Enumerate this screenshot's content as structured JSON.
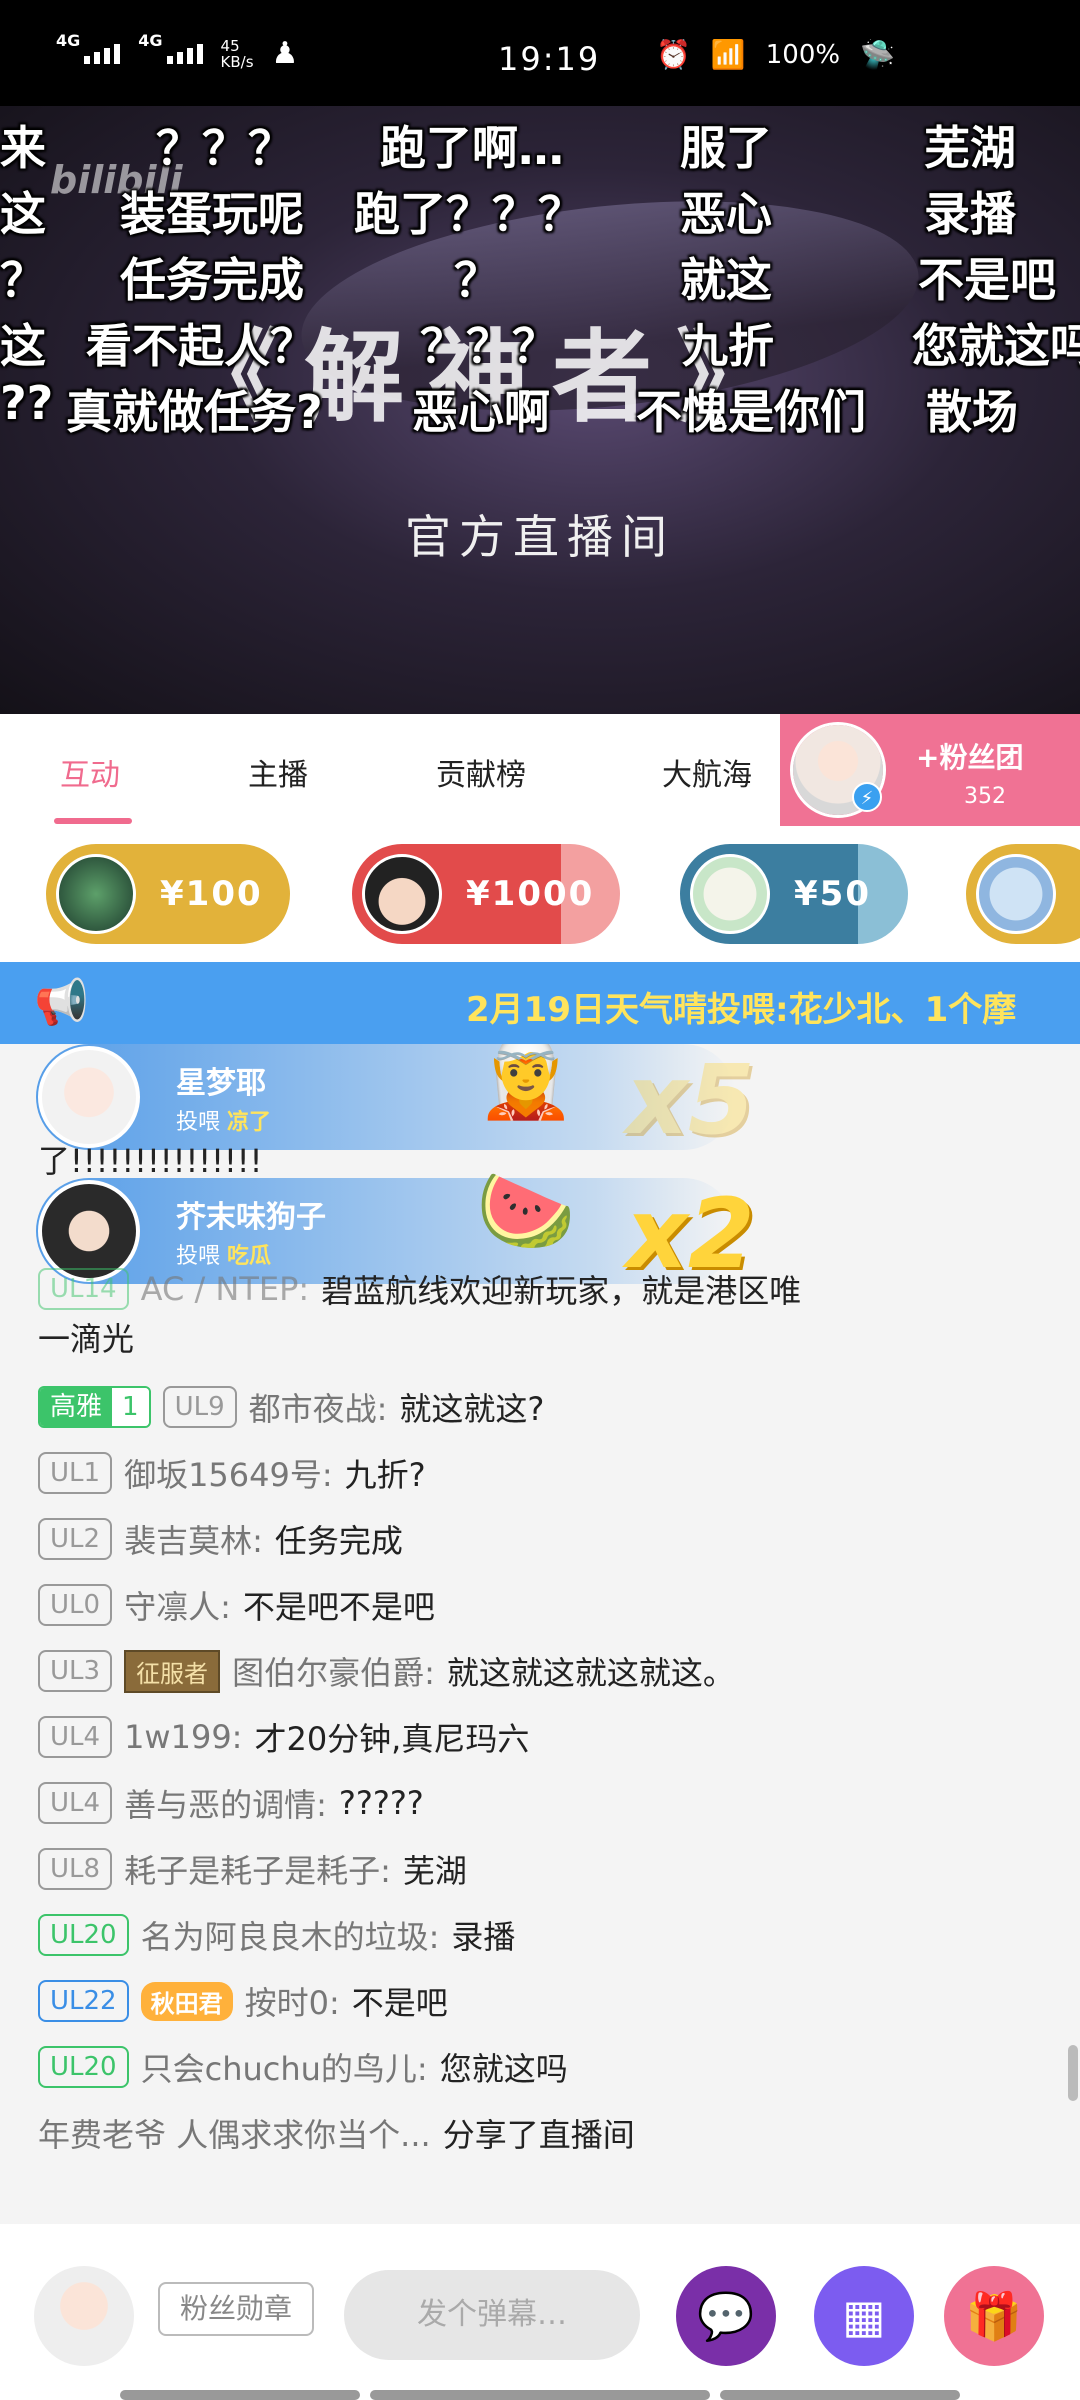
{
  "status_bar": {
    "net1": "4G",
    "net2": "4G",
    "speed_value": "45",
    "speed_unit": "KB/s",
    "time": "19:19",
    "battery": "100%"
  },
  "video": {
    "watermark": "bilibili",
    "title": "《解神者》",
    "subtitle": "官方直播间",
    "danmaku": [
      "来",
      "？？？",
      "跑了啊…",
      "服了",
      "芜湖",
      "这",
      "装蛋玩呢",
      "跑了？？？",
      "恶心",
      "录播",
      "？",
      "任务完成",
      "？",
      "就这",
      "不是吧",
      "这",
      "看不起人？",
      "？？？",
      "九折",
      "您就这吗",
      "??",
      "真就做任务?",
      "恶心啊",
      "不愧是你们",
      "散场"
    ]
  },
  "tabs": [
    "互动",
    "主播",
    "贡献榜",
    "大航海"
  ],
  "fans_club": {
    "label": "+粉丝团",
    "count": "352"
  },
  "gift_pills": [
    "¥100",
    "¥1000",
    "¥50",
    ""
  ],
  "announcement": "2月19日天气晴投喂:花少北、1个摩",
  "gift_banners": [
    {
      "name": "星梦耶",
      "prefix": "投喂",
      "item": "凉了",
      "mult": "x5"
    },
    {
      "name": "芥末味狗子",
      "prefix": "投喂",
      "item": "吃瓜",
      "mult": "x2"
    }
  ],
  "chat": [
    {
      "level": "",
      "name": "",
      "text": "了!!!!!!!!!!!!!!!"
    },
    {
      "level": "UL14",
      "name": "AC / NTEP:",
      "text": "碧蓝航线欢迎新玩家，就是港区唯"
    },
    {
      "level": "",
      "name": "",
      "text": "一滴光"
    },
    {
      "medal_name": "高雅",
      "medal_level": "1",
      "level": "UL9",
      "name": "都市夜战:",
      "text": "就这就这?"
    },
    {
      "level": "UL1",
      "name": "御坂15649号:",
      "text": "九折?"
    },
    {
      "level": "UL2",
      "name": "裴吉莫林:",
      "text": "任务完成"
    },
    {
      "level": "UL0",
      "name": "守凛人:",
      "text": "不是吧不是吧"
    },
    {
      "level": "UL3",
      "title": "征服者",
      "name": "图伯尔豪伯爵:",
      "text": "就这就这就这就这。"
    },
    {
      "level": "UL4",
      "name": "1w199:",
      "text": "才20分钟,真尼玛六"
    },
    {
      "level": "UL4",
      "name": "善与恶的调情:",
      "text": "?????"
    },
    {
      "level": "UL8",
      "name": "耗子是耗子是耗子:",
      "text": "芜湖"
    },
    {
      "level": "UL20",
      "name": "名为阿良良木的垃圾:",
      "text": "录播"
    },
    {
      "level": "UL22",
      "badge": "秋田君",
      "name": "按时0:",
      "text": "不是吧"
    },
    {
      "level": "UL20",
      "name": "只会chuchu的鸟儿:",
      "text": "您就这吗"
    },
    {
      "level": "",
      "name": "年费老爷 人偶求求你当个...",
      "text": "分享了直播间"
    }
  ],
  "bottom": {
    "fan_medal": "粉丝勋章",
    "input_placeholder": "发个弹幕…"
  },
  "colors": {
    "accent": "#f06b8e",
    "announce_bg": "#4a9ff0",
    "fans_bg": "#f07294"
  }
}
